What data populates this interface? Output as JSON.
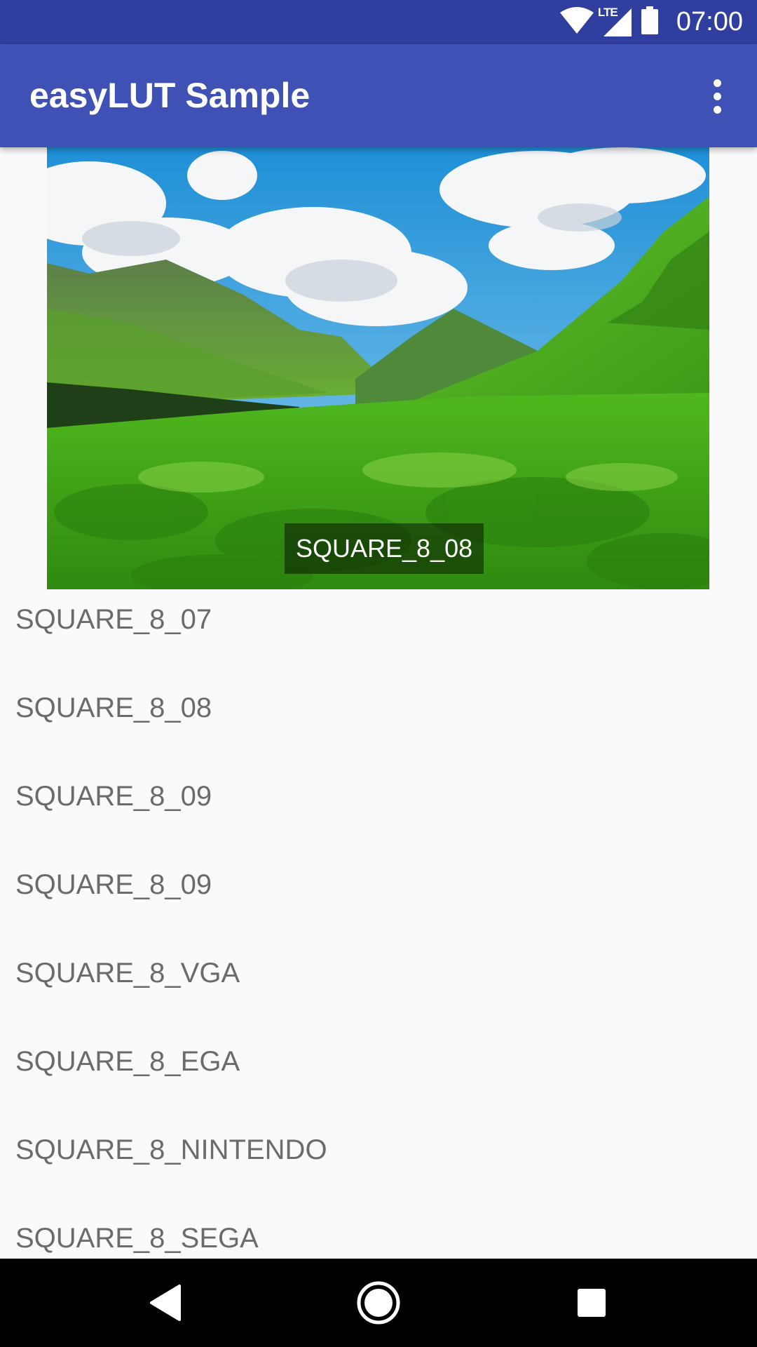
{
  "status_bar": {
    "time": "07:00",
    "network_label": "LTE",
    "icons": [
      "wifi-icon",
      "cell-signal-icon",
      "battery-icon"
    ]
  },
  "app_bar": {
    "title": "easyLUT Sample",
    "overflow_icon": "more-vert-icon"
  },
  "preview": {
    "caption": "SQUARE_8_08"
  },
  "filters": [
    "SQUARE_8_07",
    "SQUARE_8_08",
    "SQUARE_8_09",
    "SQUARE_8_09",
    "SQUARE_8_VGA",
    "SQUARE_8_EGA",
    "SQUARE_8_NINTENDO",
    "SQUARE_8_SEGA"
  ],
  "nav_bar": {
    "icons": [
      "back-icon",
      "home-icon",
      "recents-icon"
    ]
  },
  "colors": {
    "status_bar": "#303f9f",
    "app_bar": "#3f51b5",
    "list_text": "#6b6b6b"
  }
}
